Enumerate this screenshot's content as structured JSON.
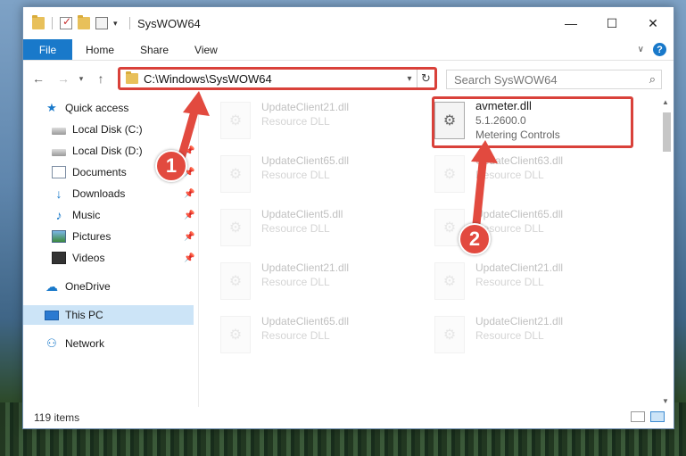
{
  "window": {
    "title": "SysWOW64",
    "controls": {
      "minimize": "—",
      "maximize": "☐",
      "close": "✕"
    }
  },
  "ribbon": {
    "tabs": [
      "File",
      "Home",
      "Share",
      "View"
    ]
  },
  "nav": {
    "address": "C:\\Windows\\SysWOW64",
    "search_placeholder": "Search SysWOW64"
  },
  "sidebar": {
    "quick_access": "Quick access",
    "items": [
      {
        "label": "Local Disk (C:)",
        "pinned": true
      },
      {
        "label": "Local Disk (D:)",
        "pinned": true
      },
      {
        "label": "Documents",
        "pinned": true
      },
      {
        "label": "Downloads",
        "pinned": true
      },
      {
        "label": "Music",
        "pinned": true
      },
      {
        "label": "Pictures",
        "pinned": true
      },
      {
        "label": "Videos",
        "pinned": true
      }
    ],
    "onedrive": "OneDrive",
    "this_pc": "This PC",
    "network": "Network"
  },
  "files": [
    {
      "name": "UpdateClient21.dll",
      "desc": "Resource DLL"
    },
    {
      "name": "avmeter.dll",
      "version": "5.1.2600.0",
      "desc": "Metering Controls"
    },
    {
      "name": "UpdateClient65.dll",
      "desc": "Resource DLL"
    },
    {
      "name": "UpdateClient63.dll",
      "desc": "Resource DLL"
    },
    {
      "name": "UpdateClient5.dll",
      "desc": "Resource DLL"
    },
    {
      "name": "UpdateClient65.dll",
      "desc": "Resource DLL"
    },
    {
      "name": "UpdateClient21.dll",
      "desc": "Resource DLL"
    },
    {
      "name": "UpdateClient21.dll",
      "desc": "Resource DLL"
    },
    {
      "name": "UpdateClient65.dll",
      "desc": "Resource DLL"
    },
    {
      "name": "UpdateClient21.dll",
      "desc": "Resource DLL"
    }
  ],
  "status": {
    "item_count": "119 items"
  },
  "annotations": {
    "step1": "1",
    "step2": "2",
    "color": "#e24a3f"
  }
}
